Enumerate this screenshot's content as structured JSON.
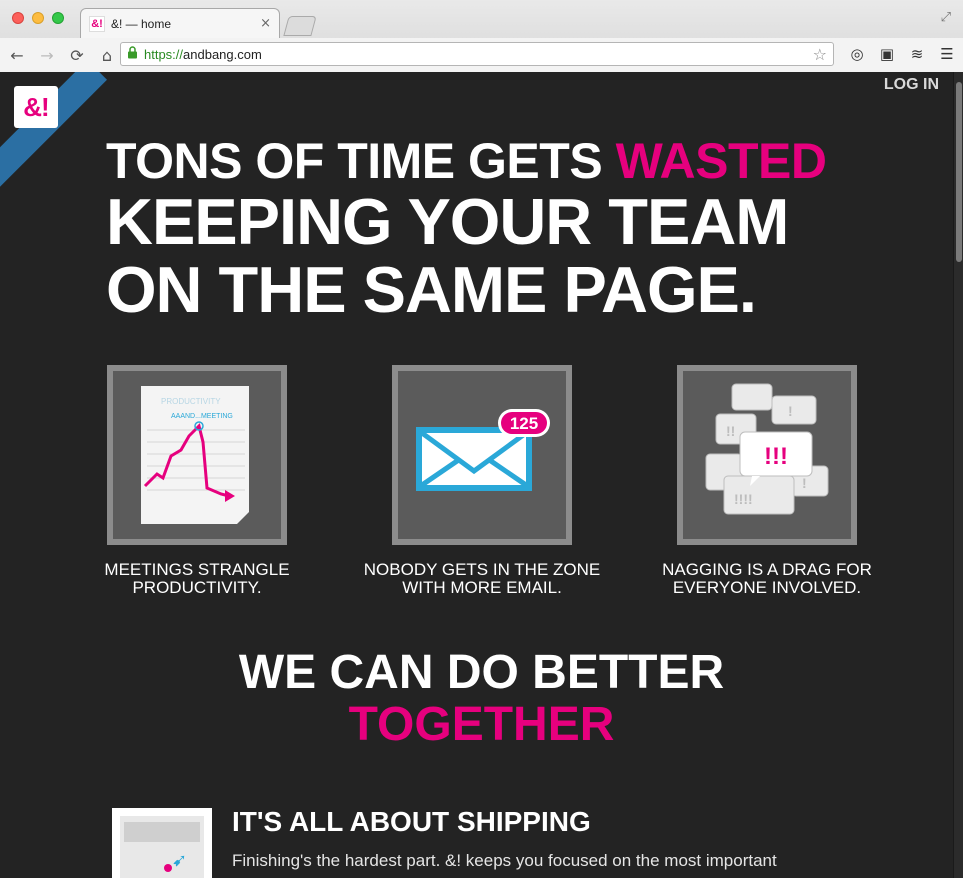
{
  "browser": {
    "tab_title": "&! — home",
    "tab_favicon": "&!",
    "close_glyph": "×",
    "url_scheme": "https://",
    "url_host": "andbang.com"
  },
  "page": {
    "logo_text": "&!",
    "login_label": "LOG IN",
    "hero": {
      "line1_a": "TONS OF TIME GETS ",
      "line1_b": "WASTED",
      "line2": "KEEPING YOUR TEAM",
      "line3": "ON THE SAME PAGE."
    },
    "features": [
      {
        "caption_a": "MEETINGS STRANGLE",
        "caption_b": "PRODUCTIVITY.",
        "chart_title": "PRODUCTIVITY",
        "chart_label": "AAAND...MEETING"
      },
      {
        "caption_a": "NOBODY GETS IN THE ZONE",
        "caption_b": "WITH MORE EMAIL.",
        "badge": "125"
      },
      {
        "caption_a": "NAGGING IS A DRAG FOR",
        "caption_b": "EVERYONE INVOLVED.",
        "bubble_text": "!!!"
      }
    ],
    "tagline_a": "WE CAN DO BETTER",
    "tagline_b": "TOGETHER",
    "shipping": {
      "title": "IT'S ALL ABOUT SHIPPING",
      "text": "Finishing's the hardest part. &! keeps you focused on the most important"
    }
  },
  "colors": {
    "accent_pink": "#e6007e",
    "email_blue": "#2aa8d8",
    "ribbon_blue": "#2b6fa3",
    "page_bg": "#232323"
  }
}
